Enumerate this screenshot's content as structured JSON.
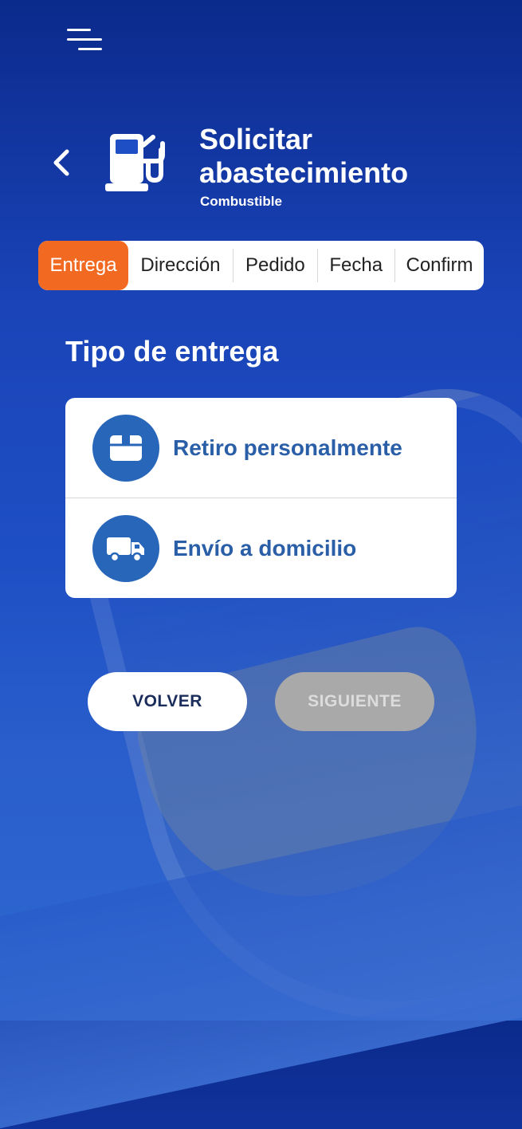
{
  "header": {
    "title": "Solicitar abastecimiento",
    "subtitle": "Combustible",
    "menu_icon": "hamburger-menu-icon",
    "back_icon": "chevron-left-icon",
    "category_icon": "fuel-pump-icon"
  },
  "steps": [
    {
      "label": "Entrega",
      "active": true
    },
    {
      "label": "Dirección",
      "active": false
    },
    {
      "label": "Pedido",
      "active": false
    },
    {
      "label": "Fecha",
      "active": false
    },
    {
      "label": "Confirm",
      "active": false
    }
  ],
  "delivery": {
    "title": "Tipo de entrega",
    "options": [
      {
        "label": "Retiro personalmente",
        "icon": "box-icon"
      },
      {
        "label": "Envío a domicilio",
        "icon": "truck-icon"
      }
    ]
  },
  "actions": {
    "back_label": "VOLVER",
    "next_label": "SIGUIENTE",
    "next_enabled": false
  },
  "colors": {
    "background": "#1a44b8",
    "accent": "#f26a21",
    "option_icon_bg": "#2766b8",
    "option_text": "#2a5fa8",
    "disabled_button": "#a9a9a9"
  }
}
